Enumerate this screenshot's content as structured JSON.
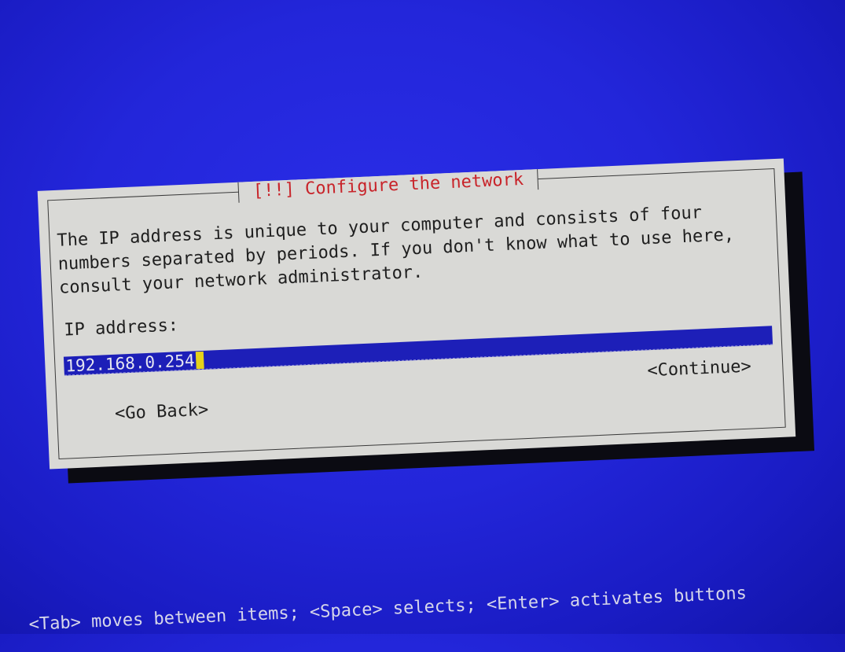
{
  "dialog": {
    "title": "[!!] Configure the network",
    "prompt": "The IP address is unique to your computer and consists of four\nnumbers separated by periods.  If you don't know what to use here,\nconsult your network administrator.",
    "field_label": "IP address:",
    "ip_value": "192.168.0.254",
    "continue_label": "<Continue>",
    "back_label": "<Go Back>"
  },
  "help_bar": "<Tab> moves between items; <Space> selects; <Enter> activates buttons",
  "colors": {
    "background": "#2326da",
    "dialog": "#d9d9d6",
    "title": "#c8242a",
    "field": "#1d1fb8",
    "cursor": "#e6d21a"
  }
}
